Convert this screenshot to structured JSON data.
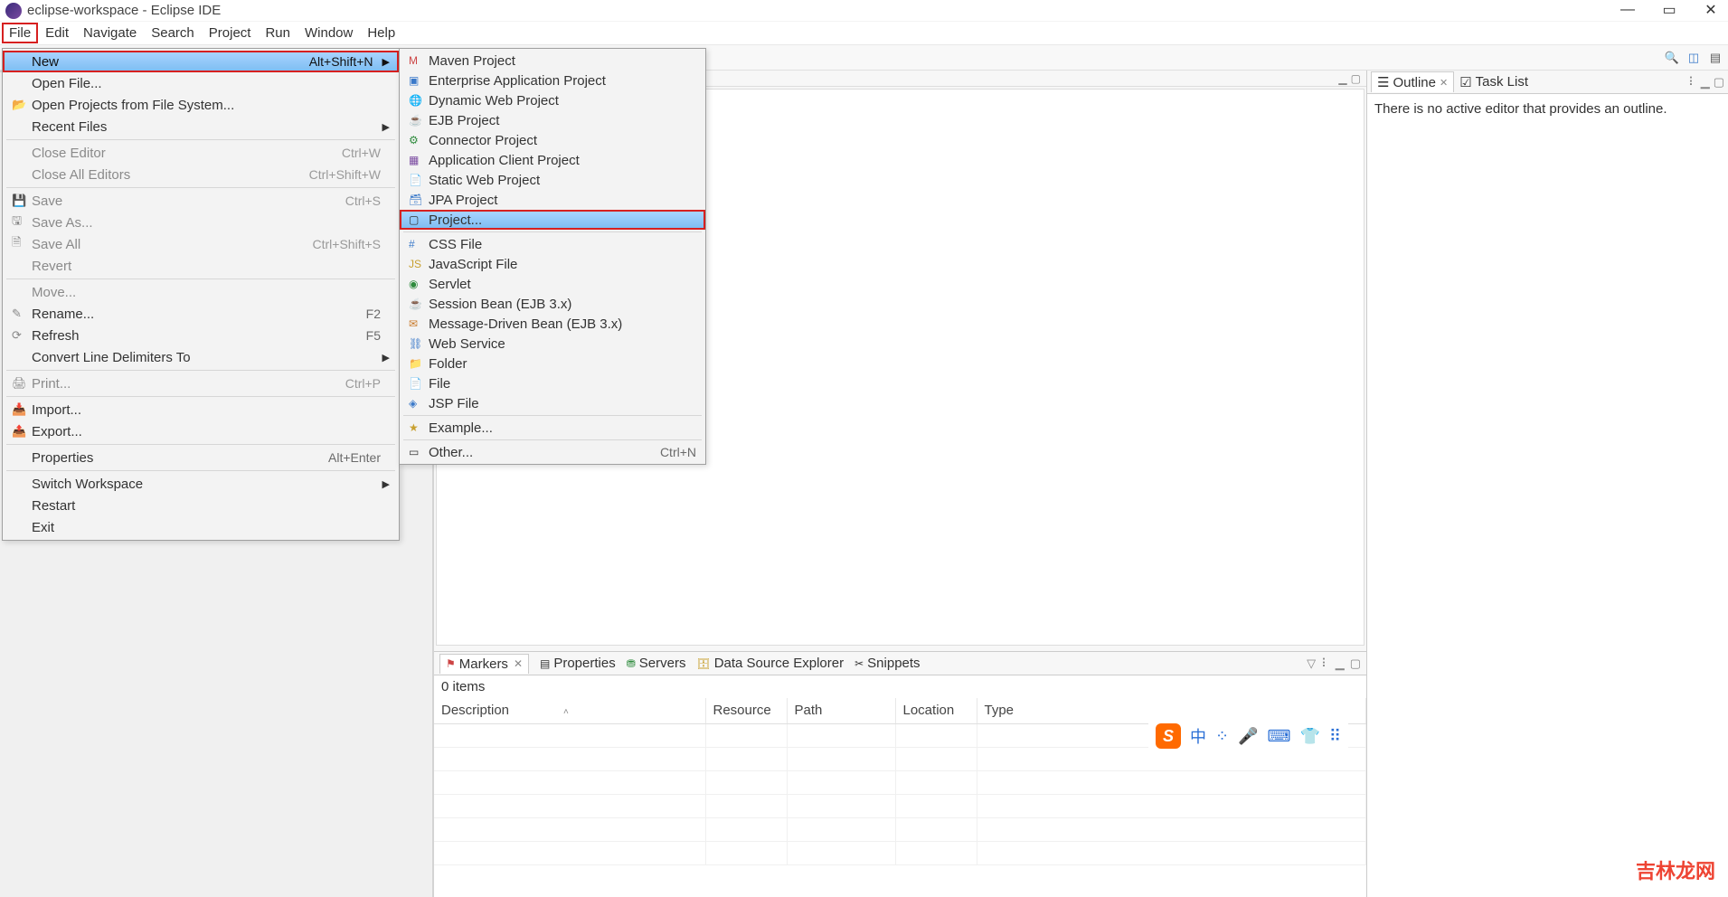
{
  "window": {
    "title": "eclipse-workspace - Eclipse IDE"
  },
  "menubar": [
    "File",
    "Edit",
    "Navigate",
    "Search",
    "Project",
    "Run",
    "Window",
    "Help"
  ],
  "file_menu": {
    "new": {
      "label": "New",
      "shortcut": "Alt+Shift+N"
    },
    "open_file": {
      "label": "Open File..."
    },
    "open_projects": {
      "label": "Open Projects from File System..."
    },
    "recent": {
      "label": "Recent Files"
    },
    "close_editor": {
      "label": "Close Editor",
      "shortcut": "Ctrl+W"
    },
    "close_all": {
      "label": "Close All Editors",
      "shortcut": "Ctrl+Shift+W"
    },
    "save": {
      "label": "Save",
      "shortcut": "Ctrl+S"
    },
    "save_as": {
      "label": "Save As..."
    },
    "save_all": {
      "label": "Save All",
      "shortcut": "Ctrl+Shift+S"
    },
    "revert": {
      "label": "Revert"
    },
    "move": {
      "label": "Move..."
    },
    "rename": {
      "label": "Rename...",
      "shortcut": "F2"
    },
    "refresh": {
      "label": "Refresh",
      "shortcut": "F5"
    },
    "line_delim": {
      "label": "Convert Line Delimiters To"
    },
    "print": {
      "label": "Print...",
      "shortcut": "Ctrl+P"
    },
    "import": {
      "label": "Import..."
    },
    "export": {
      "label": "Export..."
    },
    "properties": {
      "label": "Properties",
      "shortcut": "Alt+Enter"
    },
    "switch_ws": {
      "label": "Switch Workspace"
    },
    "restart": {
      "label": "Restart"
    },
    "exit": {
      "label": "Exit"
    }
  },
  "new_menu": {
    "maven": {
      "label": "Maven Project"
    },
    "ear": {
      "label": "Enterprise Application Project"
    },
    "dynweb": {
      "label": "Dynamic Web Project"
    },
    "ejb": {
      "label": "EJB Project"
    },
    "connector": {
      "label": "Connector Project"
    },
    "appclient": {
      "label": "Application Client Project"
    },
    "staticweb": {
      "label": "Static Web Project"
    },
    "jpa": {
      "label": "JPA Project"
    },
    "project": {
      "label": "Project..."
    },
    "css": {
      "label": "CSS File"
    },
    "js": {
      "label": "JavaScript File"
    },
    "servlet": {
      "label": "Servlet"
    },
    "session": {
      "label": "Session Bean (EJB 3.x)"
    },
    "mdb": {
      "label": "Message-Driven Bean (EJB 3.x)"
    },
    "ws": {
      "label": "Web Service"
    },
    "folder": {
      "label": "Folder"
    },
    "file": {
      "label": "File"
    },
    "jsp": {
      "label": "JSP File"
    },
    "example": {
      "label": "Example..."
    },
    "other": {
      "label": "Other...",
      "shortcut": "Ctrl+N"
    }
  },
  "outline": {
    "tab1": "Outline",
    "tab2": "Task List",
    "body": "There is no active editor that provides an outline."
  },
  "markers": {
    "tabs": [
      "Markers",
      "Properties",
      "Servers",
      "Data Source Explorer",
      "Snippets"
    ],
    "count": "0 items",
    "cols": [
      "Description",
      "Resource",
      "Path",
      "Location",
      "Type"
    ]
  },
  "ime": {
    "chars": [
      "中",
      "⁘",
      "🎤",
      "⌨",
      "👕",
      "⠿"
    ]
  },
  "watermark": "吉林龙网"
}
